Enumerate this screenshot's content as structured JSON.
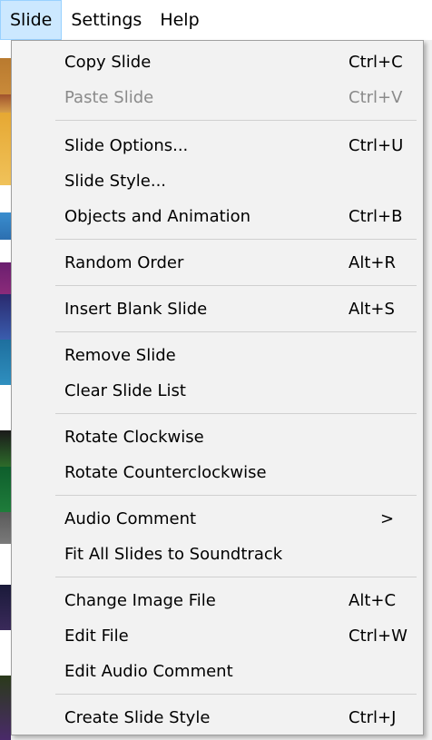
{
  "menubar": {
    "items": [
      {
        "label": "Slide"
      },
      {
        "label": "Settings"
      },
      {
        "label": "Help"
      }
    ]
  },
  "menu": {
    "items": [
      {
        "label": "Copy Slide",
        "shortcut": "Ctrl+C"
      },
      {
        "label": "Paste Slide",
        "shortcut": "Ctrl+V",
        "disabled": true
      },
      {
        "label": "Slide Options...",
        "shortcut": "Ctrl+U"
      },
      {
        "label": "Slide Style...",
        "shortcut": ""
      },
      {
        "label": "Objects and Animation",
        "shortcut": "Ctrl+B"
      },
      {
        "label": "Random Order",
        "shortcut": "Alt+R"
      },
      {
        "label": "Insert Blank Slide",
        "shortcut": "Alt+S"
      },
      {
        "label": "Remove Slide",
        "shortcut": ""
      },
      {
        "label": "Clear Slide List",
        "shortcut": ""
      },
      {
        "label": "Rotate Clockwise",
        "shortcut": ""
      },
      {
        "label": "Rotate Counterclockwise",
        "shortcut": ""
      },
      {
        "label": "Audio Comment",
        "shortcut": "",
        "submenu_arrow": ">"
      },
      {
        "label": "Fit All Slides to Soundtrack",
        "shortcut": ""
      },
      {
        "label": "Change Image File",
        "shortcut": "Alt+C"
      },
      {
        "label": "Edit File",
        "shortcut": "Ctrl+W"
      },
      {
        "label": "Edit Audio Comment",
        "shortcut": ""
      },
      {
        "label": "Create Slide Style",
        "shortcut": "Ctrl+J"
      }
    ]
  }
}
